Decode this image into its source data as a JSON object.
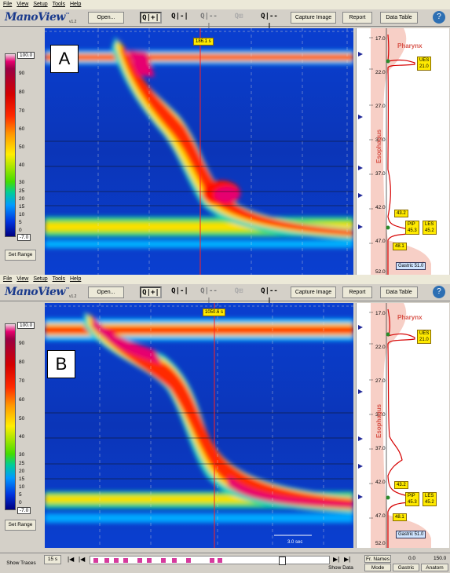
{
  "menu": [
    "File",
    "View",
    "Setup",
    "Tools",
    "Help"
  ],
  "app": {
    "name": "ManoView",
    "trademark": "™",
    "sublogo": "ANALYSIS",
    "version": "v1.2"
  },
  "toolbar": {
    "open": "Open...",
    "capture": "Capture Image",
    "report": "Report",
    "data_table": "Data Table",
    "zoom_glyphs": [
      "Q|+|",
      "Q|-|",
      "Q|--|",
      "Q⊞",
      "Q|--|"
    ]
  },
  "help_icon": "?",
  "colorbar": {
    "top_value": "100.0",
    "ticks": [
      "90",
      "80",
      "70",
      "60",
      "50",
      "40",
      "30",
      "25",
      "20",
      "15",
      "10",
      "5",
      "0"
    ],
    "bottom_value": "-7.0",
    "set_range": "Set Range"
  },
  "panels": [
    {
      "label": "A",
      "time_marker": "186.1 s"
    },
    {
      "label": "B",
      "time_marker": "1050.6 s"
    }
  ],
  "sidebar": {
    "depths": [
      "17.0",
      "22.0",
      "27.0",
      "32.0",
      "37.0",
      "42.0",
      "47.0",
      "52.0"
    ],
    "pharynx": "Pharynx",
    "esophagus": "Esophagus",
    "stomach_partial": "ch",
    "ues": [
      "UES",
      "21.0"
    ],
    "pip": [
      "PIP",
      "45.3"
    ],
    "les": [
      "LES",
      "45.2"
    ],
    "val_43": "43.2",
    "val_48": "48.1",
    "gastric": "Gastric 51.0"
  },
  "bottom": {
    "show_traces": "Show Traces",
    "interval": "15 s",
    "scale_bar": "3.0 sec",
    "show_data": "Show Data",
    "fr_names": "Fr. Names",
    "range_start": "0.0",
    "range_end": "150.0",
    "mode": "Mode",
    "gastric": "Gastric",
    "anatomy": "Anatom"
  }
}
